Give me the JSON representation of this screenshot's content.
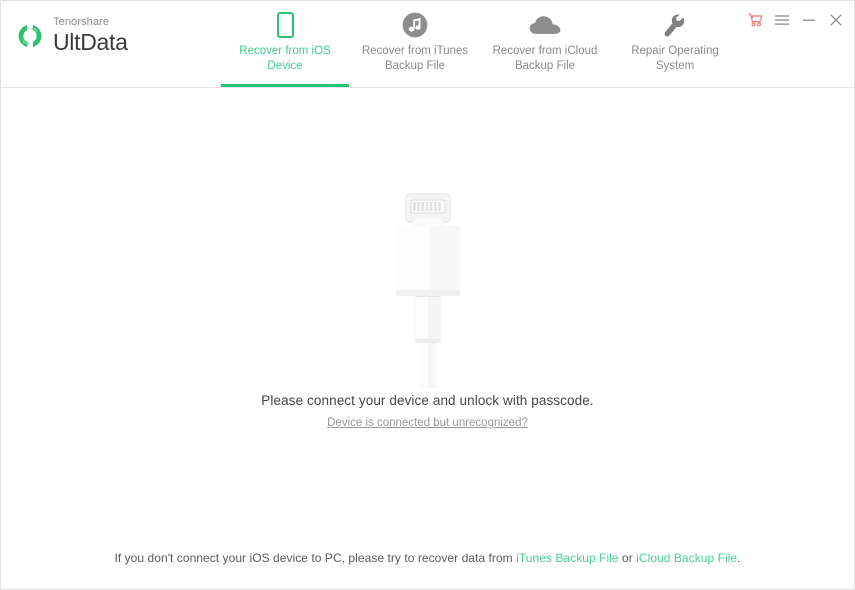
{
  "window": {
    "brand_sub": "Tenorshare",
    "brand_title": "UltData",
    "controls": [
      {
        "name": "cart-icon",
        "label": "Buy"
      },
      {
        "name": "menu-icon",
        "label": "Menu"
      },
      {
        "name": "minimize-icon",
        "label": "Minimize"
      },
      {
        "name": "close-icon",
        "label": "Close"
      }
    ]
  },
  "tabs": [
    {
      "label": "Recover from iOS Device",
      "icon": "phone-icon",
      "active": true
    },
    {
      "label": "Recover from iTunes Backup File",
      "icon": "music-note-icon",
      "active": false
    },
    {
      "label": "Recover from iCloud Backup File",
      "icon": "cloud-icon",
      "active": false
    },
    {
      "label": "Repair Operating System",
      "icon": "wrench-icon",
      "active": false
    }
  ],
  "main": {
    "illustration": "lightning-cable-illustration",
    "prompt_text": "Please connect your device and unlock with passcode.",
    "prompt_link": "Device is connected but unrecognized?"
  },
  "footer": {
    "text_before": "If you don't connect your iOS device to PC, please try to recover data from ",
    "link_itunes": "iTunes Backup File",
    "text_middle": " or ",
    "link_icloud": "iCloud Backup File",
    "text_after": "."
  },
  "colors": {
    "accent_green": "#3fcd8b",
    "underline_green": "#25c27a",
    "link_green": "#46cf90",
    "cart_red": "#f07b7b",
    "tab_gray": "#8a8a8a"
  }
}
